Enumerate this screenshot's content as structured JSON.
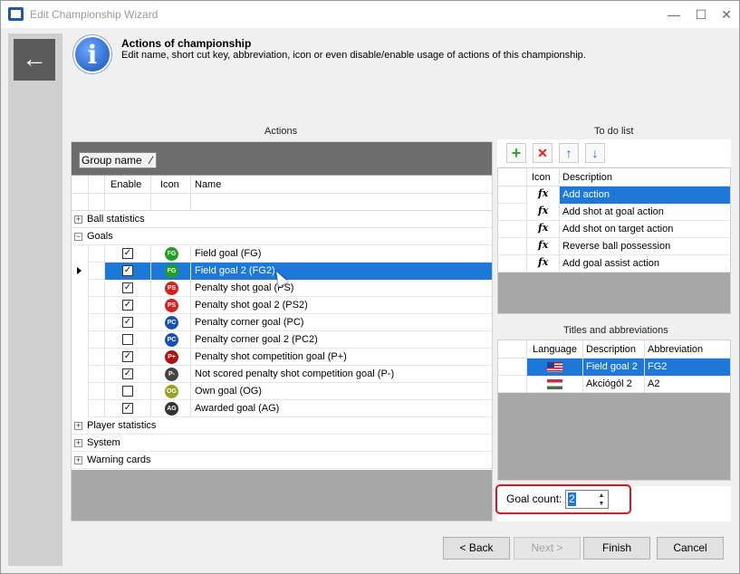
{
  "window": {
    "title": "Edit Championship Wizard",
    "minimize": "—",
    "maximize": "☐",
    "close": "✕"
  },
  "header": {
    "back_icon": "←",
    "info_icon": "i",
    "title": "Actions of championship",
    "description": "Edit name, short cut key, abbreviation, icon or even disable/enable usage of actions of this championship."
  },
  "actions_panel": {
    "label": "Actions",
    "group_chip": "Group name",
    "columns": [
      "Enable",
      "Icon",
      "Name"
    ],
    "groups_before": [
      {
        "expander": "+",
        "label": "Ball statistics"
      },
      {
        "expander": "−",
        "label": "Goals"
      }
    ],
    "rows": [
      {
        "checked": true,
        "icon": "FG",
        "color": "#1fa11f",
        "name": "Field goal (FG)"
      },
      {
        "checked": true,
        "icon": "FG",
        "color": "#1fa11f",
        "name": "Field goal 2 (FG2)",
        "selected": true
      },
      {
        "checked": true,
        "icon": "PS",
        "color": "#d42020",
        "name": "Penalty shot goal (PS)"
      },
      {
        "checked": true,
        "icon": "PS",
        "color": "#d42020",
        "name": "Penalty shot goal 2 (PS2)"
      },
      {
        "checked": true,
        "icon": "PC",
        "color": "#1a4fb5",
        "name": "Penalty corner goal (PC)"
      },
      {
        "checked": false,
        "icon": "PC",
        "color": "#1a4fb5",
        "name": "Penalty corner goal 2 (PC2)"
      },
      {
        "checked": true,
        "icon": "P+",
        "color": "#b01010",
        "name": "Penalty shot competition goal (P+)"
      },
      {
        "checked": true,
        "icon": "P-",
        "color": "#444444",
        "name": "Not scored penalty shot competition goal (P-)"
      },
      {
        "checked": false,
        "icon": "OG",
        "color": "#9aa020",
        "name": "Own goal (OG)"
      },
      {
        "checked": true,
        "icon": "AG",
        "color": "#333333",
        "name": "Awarded goal (AG)"
      }
    ],
    "groups_after": [
      {
        "expander": "+",
        "label": "Player statistics"
      },
      {
        "expander": "+",
        "label": "System"
      },
      {
        "expander": "+",
        "label": "Warning cards"
      }
    ]
  },
  "todo_panel": {
    "label": "To do list",
    "toolbar": {
      "add": "+",
      "remove": "✕",
      "up": "↑",
      "down": "↓"
    },
    "columns": [
      "Icon",
      "Description"
    ],
    "rows": [
      {
        "icon": "fx",
        "description": "Add action",
        "selected": true
      },
      {
        "icon": "fx",
        "description": "Add shot at goal action"
      },
      {
        "icon": "fx",
        "description": "Add shot on target action"
      },
      {
        "icon": "fx",
        "description": "Reverse ball possession"
      },
      {
        "icon": "fx",
        "description": "Add goal assist action"
      }
    ]
  },
  "titles_panel": {
    "label": "Titles and abbreviations",
    "columns": [
      "Language",
      "Description",
      "Abbreviation"
    ],
    "rows": [
      {
        "flag": "us-flag",
        "description": "Field goal 2",
        "abbreviation": "FG2",
        "selected": true
      },
      {
        "flag": "hu-flag",
        "description": "Akciógól 2",
        "abbreviation": "A2"
      }
    ]
  },
  "goal_count": {
    "label": "Goal count:",
    "value": "2"
  },
  "buttons": {
    "back": "< Back",
    "next": "Next >",
    "finish": "Finish",
    "cancel": "Cancel"
  }
}
